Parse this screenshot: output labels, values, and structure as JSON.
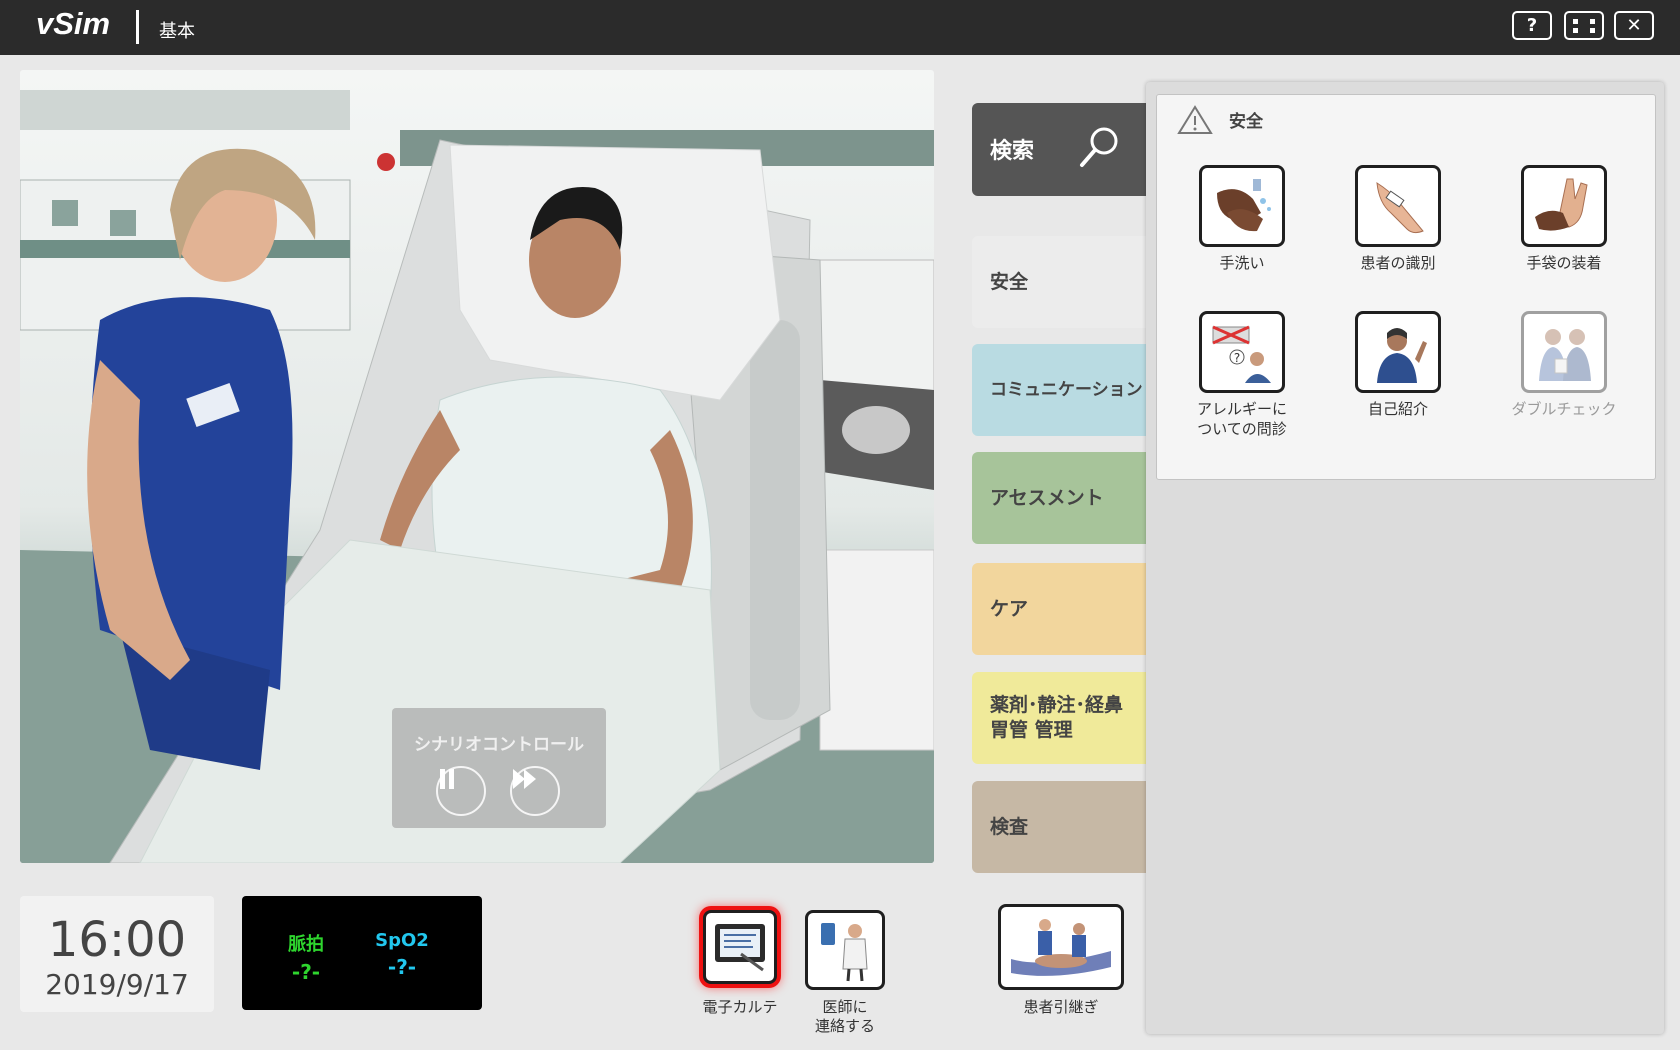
{
  "app": {
    "brand": "vSim",
    "mode": "基本"
  },
  "topbar": {
    "help": "?",
    "close": "✕"
  },
  "scene": {
    "scenario_control_label": "シナリオコントロール"
  },
  "clock": {
    "time": "16:00",
    "date": "2019/9/17"
  },
  "vitals": {
    "pulse": {
      "label": "脈拍",
      "value": "-?-"
    },
    "spo2": {
      "label": "SpO2",
      "value": "-?-"
    }
  },
  "bottom": {
    "ehr": "電子カルテ",
    "doctor_line1": "医師に",
    "doctor_line2": "連絡する",
    "handoff": "患者引継ぎ"
  },
  "search": {
    "label": "検索"
  },
  "categories": {
    "safety": "安全",
    "communication": "コミュニケーション",
    "assessment": "アセスメント",
    "care": "ケア",
    "meds_line1": "薬剤･静注･経鼻",
    "meds_line2": "胃管 管理",
    "exam": "検査"
  },
  "panel": {
    "title": "安全",
    "actions": [
      {
        "label": "手洗い"
      },
      {
        "label": "患者の識別"
      },
      {
        "label": "手袋の装着"
      },
      {
        "label_line1": "アレルギーに",
        "label_line2": "ついての問診"
      },
      {
        "label": "自己紹介"
      },
      {
        "label": "ダブルチェック",
        "disabled": true
      }
    ]
  }
}
